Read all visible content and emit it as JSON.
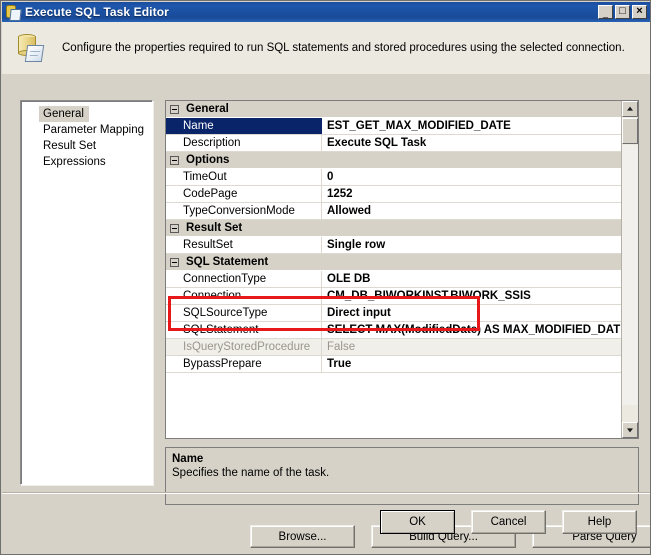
{
  "window": {
    "title": "Execute SQL Task Editor",
    "icon": "sql-task-icon",
    "controls": {
      "minimize": "_",
      "maximize": "□",
      "close": "×"
    }
  },
  "header": {
    "icon": "database-document-icon",
    "description": "Configure the properties required to run SQL statements and stored procedures using the selected connection."
  },
  "sidebar": {
    "items": [
      {
        "label": "General",
        "selected": true
      },
      {
        "label": "Parameter Mapping",
        "selected": false
      },
      {
        "label": "Result Set",
        "selected": false
      },
      {
        "label": "Expressions",
        "selected": false
      }
    ]
  },
  "property_grid": {
    "rows": [
      {
        "type": "category",
        "label": "General"
      },
      {
        "type": "property",
        "name": "Name",
        "value": "EST_GET_MAX_MODIFIED_DATE",
        "selected": true,
        "disabled": false
      },
      {
        "type": "property",
        "name": "Description",
        "value": "Execute SQL Task",
        "selected": false,
        "disabled": false
      },
      {
        "type": "category",
        "label": "Options"
      },
      {
        "type": "property",
        "name": "TimeOut",
        "value": "0",
        "selected": false,
        "disabled": false
      },
      {
        "type": "property",
        "name": "CodePage",
        "value": "1252",
        "selected": false,
        "disabled": false
      },
      {
        "type": "property",
        "name": "TypeConversionMode",
        "value": "Allowed",
        "selected": false,
        "disabled": false
      },
      {
        "type": "category",
        "label": "Result Set"
      },
      {
        "type": "property",
        "name": "ResultSet",
        "value": "Single row",
        "selected": false,
        "disabled": false
      },
      {
        "type": "category",
        "label": "SQL Statement"
      },
      {
        "type": "property",
        "name": "ConnectionType",
        "value": "OLE DB",
        "selected": false,
        "disabled": false
      },
      {
        "type": "property",
        "name": "Connection",
        "value": "CM_DB_BIWORKINST.BIWORK_SSIS",
        "selected": false,
        "disabled": false
      },
      {
        "type": "property",
        "name": "SQLSourceType",
        "value": "Direct input",
        "selected": false,
        "disabled": false
      },
      {
        "type": "property",
        "name": "SQLStatement",
        "value": "SELECT MAX(ModifiedDate) AS MAX_MODIFIED_DAT",
        "selected": false,
        "disabled": false
      },
      {
        "type": "property",
        "name": "IsQueryStoredProcedure",
        "value": "False",
        "selected": false,
        "disabled": true
      },
      {
        "type": "property",
        "name": "BypassPrepare",
        "value": "True",
        "selected": false,
        "disabled": false
      }
    ],
    "scrollbar": {
      "up_arrow": "▲",
      "down_arrow": "▼"
    }
  },
  "annotation": {
    "color": "#e8171a",
    "target": "Result Set category and ResultSet property"
  },
  "description_pane": {
    "title": "Name",
    "text": "Specifies the name of the task."
  },
  "actions": {
    "browse": "Browse...",
    "build_query": "Build Query...",
    "parse_query": "Parse Query"
  },
  "dialog_buttons": {
    "ok": "OK",
    "cancel": "Cancel",
    "help": "Help"
  }
}
